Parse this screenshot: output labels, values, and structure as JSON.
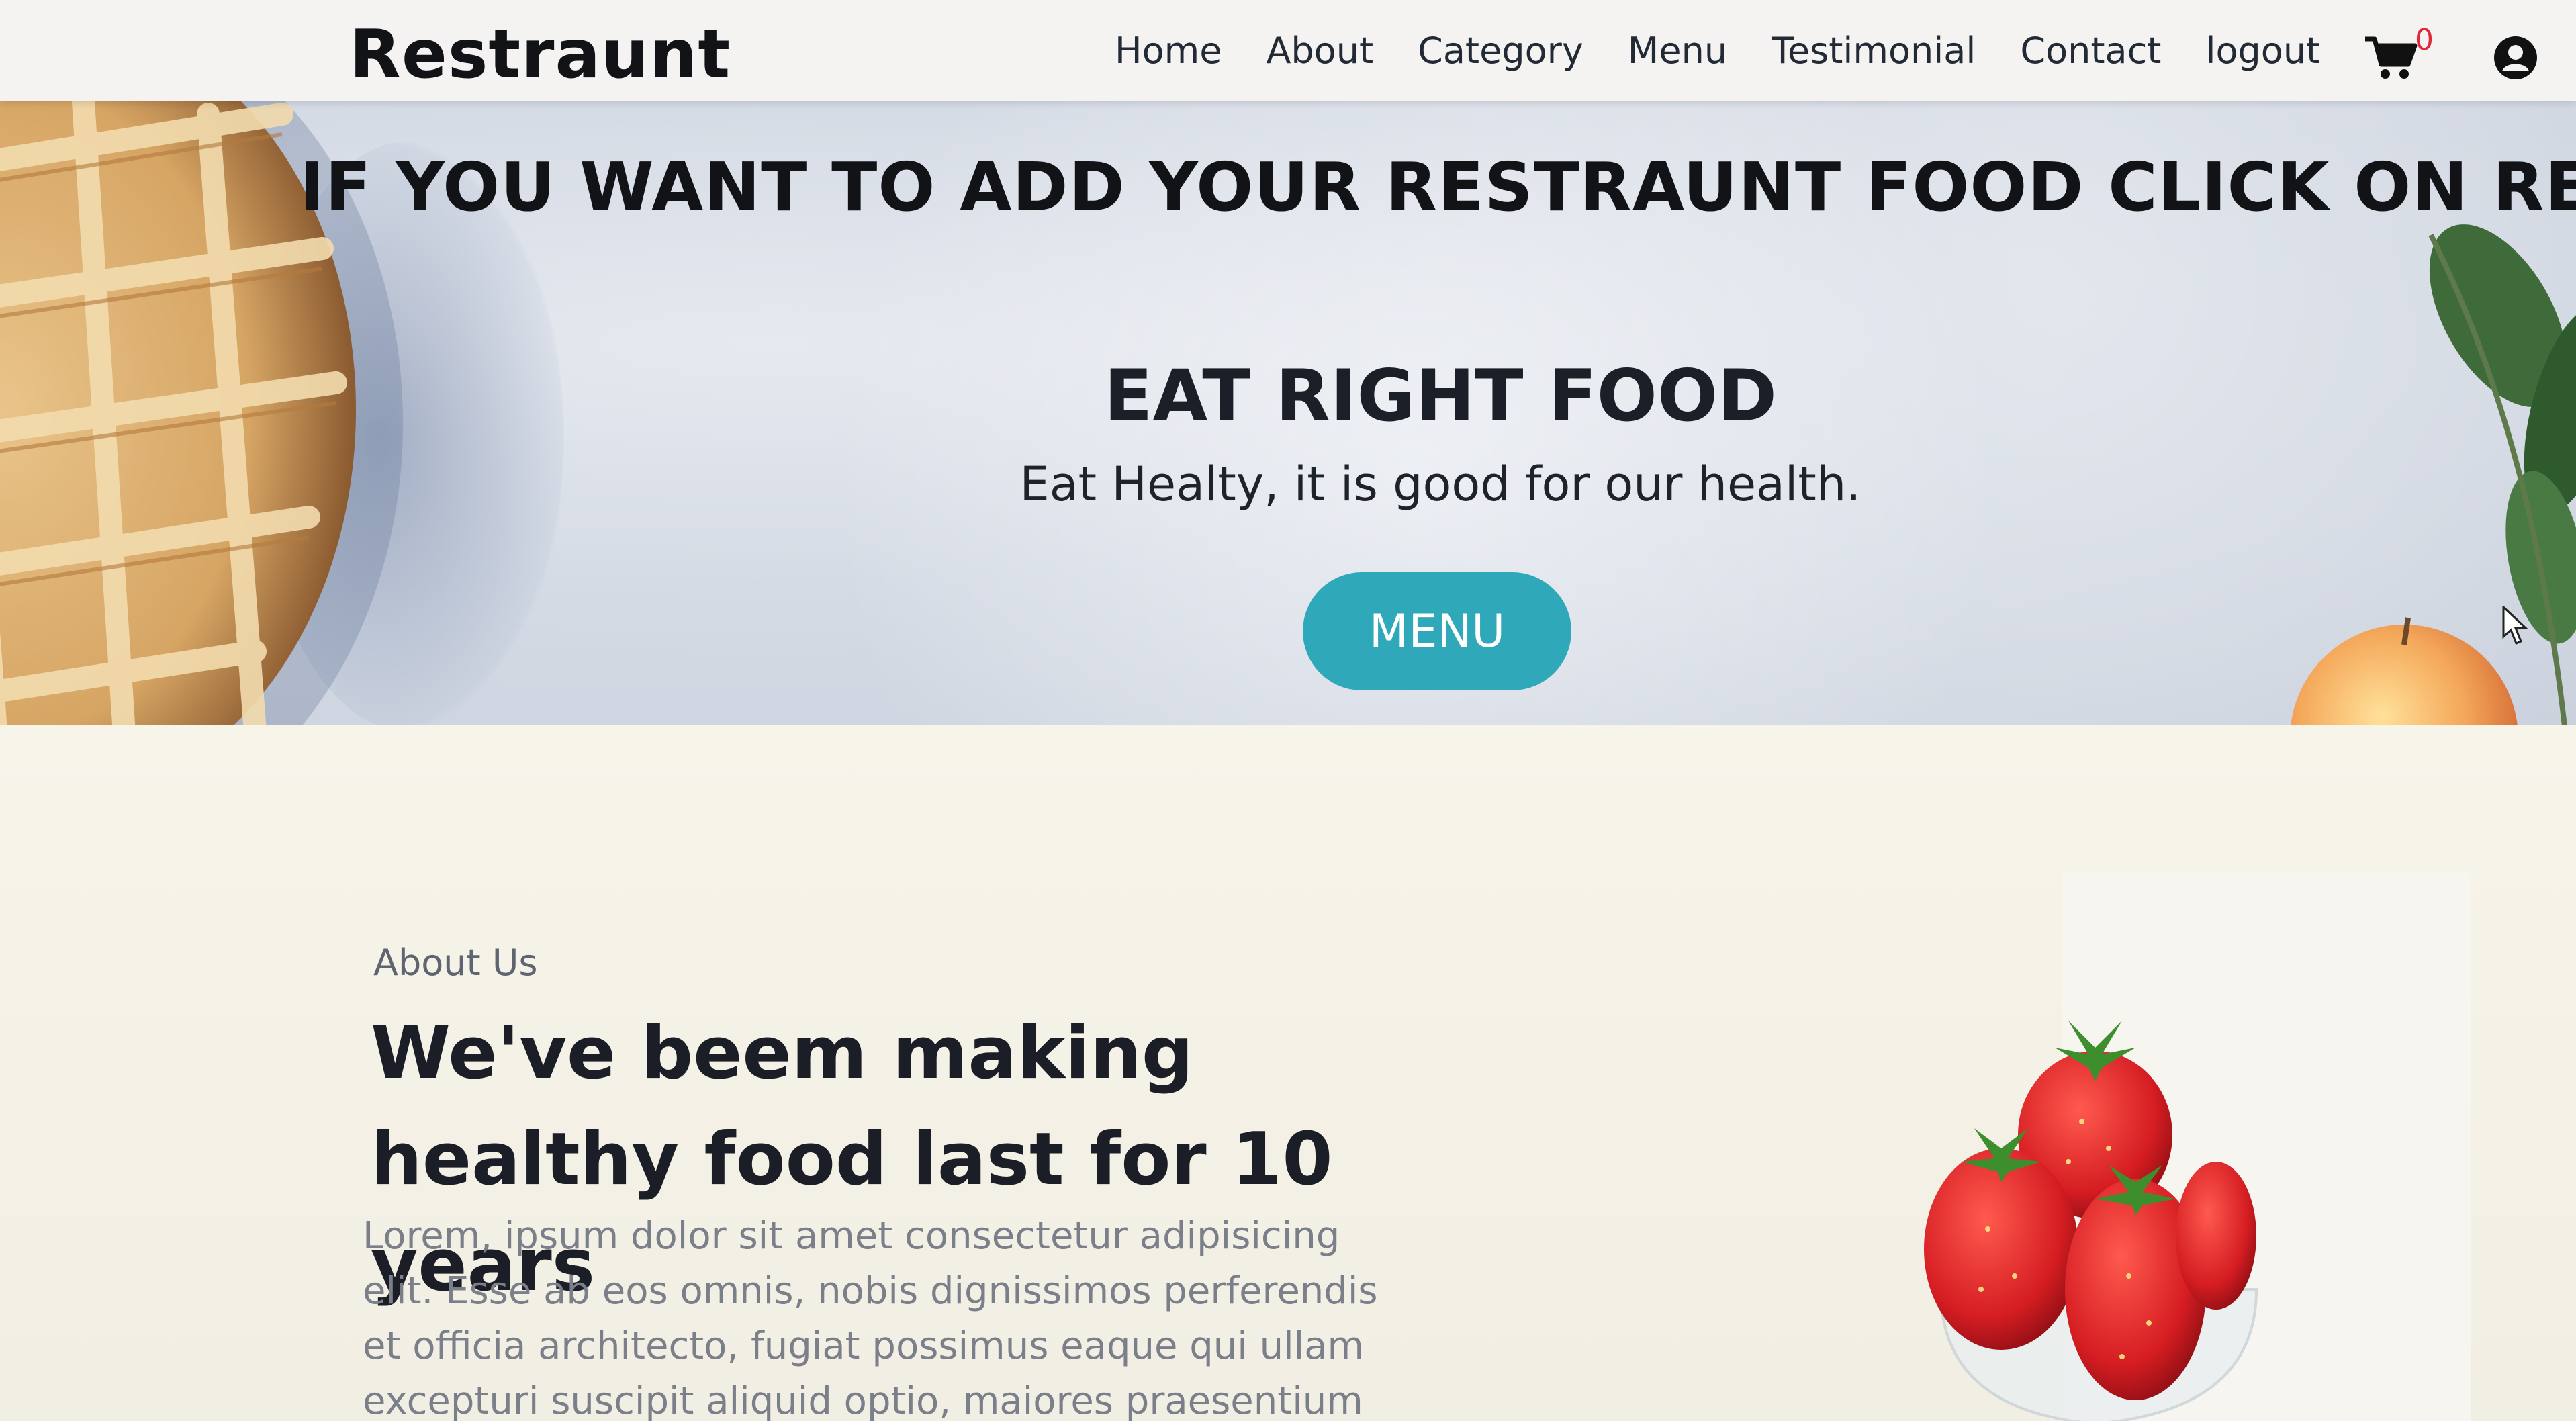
{
  "navbar": {
    "brand": "Restraunt",
    "links": [
      "Home",
      "About",
      "Category",
      "Menu",
      "Testimonial",
      "Contact",
      "logout"
    ],
    "cart_count": "0"
  },
  "hero": {
    "banner": "IF YOU WANT TO ADD YOUR RESTRAUNT FOOD CLICK ON REGISTER",
    "title": "EAT RIGHT FOOD",
    "subtitle": "Eat Healty, it is good for our health.",
    "button": "MENU"
  },
  "about": {
    "label": "About Us",
    "heading_line1": "We've beem making",
    "heading_line2": "healthy food last for 10 years",
    "text": "Lorem, ipsum dolor sit amet consectetur adipisicing elit. Esse ab eos omnis, nobis dignissimos perferendis et officia architecto, fugiat possimus eaque qui ullam excepturi suscipit aliquid optio, maiores praesentium"
  },
  "colors": {
    "accent": "#2fa8b9",
    "badge": "#e0283a"
  },
  "icons": [
    "cart-icon",
    "user-icon",
    "cursor-icon"
  ]
}
